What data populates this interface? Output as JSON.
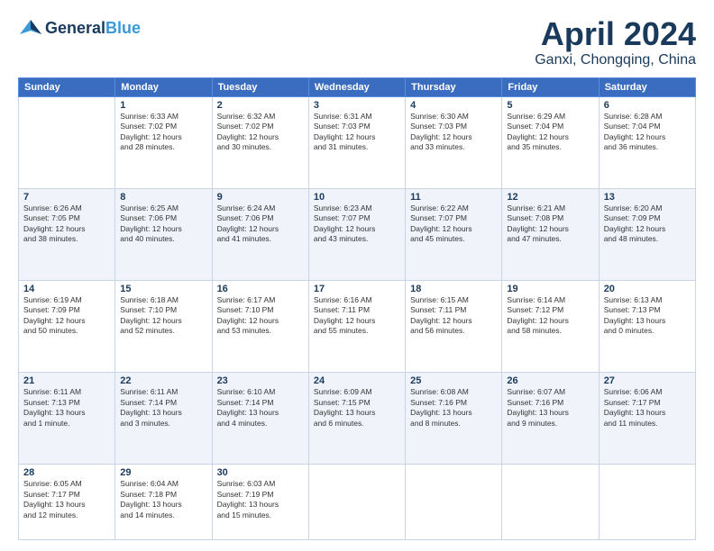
{
  "header": {
    "logo_line1": "General",
    "logo_line2": "Blue",
    "title": "April 2024",
    "subtitle": "Ganxi, Chongqing, China"
  },
  "columns": [
    "Sunday",
    "Monday",
    "Tuesday",
    "Wednesday",
    "Thursday",
    "Friday",
    "Saturday"
  ],
  "weeks": [
    [
      {
        "num": "",
        "info": ""
      },
      {
        "num": "1",
        "info": "Sunrise: 6:33 AM\nSunset: 7:02 PM\nDaylight: 12 hours\nand 28 minutes."
      },
      {
        "num": "2",
        "info": "Sunrise: 6:32 AM\nSunset: 7:02 PM\nDaylight: 12 hours\nand 30 minutes."
      },
      {
        "num": "3",
        "info": "Sunrise: 6:31 AM\nSunset: 7:03 PM\nDaylight: 12 hours\nand 31 minutes."
      },
      {
        "num": "4",
        "info": "Sunrise: 6:30 AM\nSunset: 7:03 PM\nDaylight: 12 hours\nand 33 minutes."
      },
      {
        "num": "5",
        "info": "Sunrise: 6:29 AM\nSunset: 7:04 PM\nDaylight: 12 hours\nand 35 minutes."
      },
      {
        "num": "6",
        "info": "Sunrise: 6:28 AM\nSunset: 7:04 PM\nDaylight: 12 hours\nand 36 minutes."
      }
    ],
    [
      {
        "num": "7",
        "info": "Sunrise: 6:26 AM\nSunset: 7:05 PM\nDaylight: 12 hours\nand 38 minutes."
      },
      {
        "num": "8",
        "info": "Sunrise: 6:25 AM\nSunset: 7:06 PM\nDaylight: 12 hours\nand 40 minutes."
      },
      {
        "num": "9",
        "info": "Sunrise: 6:24 AM\nSunset: 7:06 PM\nDaylight: 12 hours\nand 41 minutes."
      },
      {
        "num": "10",
        "info": "Sunrise: 6:23 AM\nSunset: 7:07 PM\nDaylight: 12 hours\nand 43 minutes."
      },
      {
        "num": "11",
        "info": "Sunrise: 6:22 AM\nSunset: 7:07 PM\nDaylight: 12 hours\nand 45 minutes."
      },
      {
        "num": "12",
        "info": "Sunrise: 6:21 AM\nSunset: 7:08 PM\nDaylight: 12 hours\nand 47 minutes."
      },
      {
        "num": "13",
        "info": "Sunrise: 6:20 AM\nSunset: 7:09 PM\nDaylight: 12 hours\nand 48 minutes."
      }
    ],
    [
      {
        "num": "14",
        "info": "Sunrise: 6:19 AM\nSunset: 7:09 PM\nDaylight: 12 hours\nand 50 minutes."
      },
      {
        "num": "15",
        "info": "Sunrise: 6:18 AM\nSunset: 7:10 PM\nDaylight: 12 hours\nand 52 minutes."
      },
      {
        "num": "16",
        "info": "Sunrise: 6:17 AM\nSunset: 7:10 PM\nDaylight: 12 hours\nand 53 minutes."
      },
      {
        "num": "17",
        "info": "Sunrise: 6:16 AM\nSunset: 7:11 PM\nDaylight: 12 hours\nand 55 minutes."
      },
      {
        "num": "18",
        "info": "Sunrise: 6:15 AM\nSunset: 7:11 PM\nDaylight: 12 hours\nand 56 minutes."
      },
      {
        "num": "19",
        "info": "Sunrise: 6:14 AM\nSunset: 7:12 PM\nDaylight: 12 hours\nand 58 minutes."
      },
      {
        "num": "20",
        "info": "Sunrise: 6:13 AM\nSunset: 7:13 PM\nDaylight: 13 hours\nand 0 minutes."
      }
    ],
    [
      {
        "num": "21",
        "info": "Sunrise: 6:11 AM\nSunset: 7:13 PM\nDaylight: 13 hours\nand 1 minute."
      },
      {
        "num": "22",
        "info": "Sunrise: 6:11 AM\nSunset: 7:14 PM\nDaylight: 13 hours\nand 3 minutes."
      },
      {
        "num": "23",
        "info": "Sunrise: 6:10 AM\nSunset: 7:14 PM\nDaylight: 13 hours\nand 4 minutes."
      },
      {
        "num": "24",
        "info": "Sunrise: 6:09 AM\nSunset: 7:15 PM\nDaylight: 13 hours\nand 6 minutes."
      },
      {
        "num": "25",
        "info": "Sunrise: 6:08 AM\nSunset: 7:16 PM\nDaylight: 13 hours\nand 8 minutes."
      },
      {
        "num": "26",
        "info": "Sunrise: 6:07 AM\nSunset: 7:16 PM\nDaylight: 13 hours\nand 9 minutes."
      },
      {
        "num": "27",
        "info": "Sunrise: 6:06 AM\nSunset: 7:17 PM\nDaylight: 13 hours\nand 11 minutes."
      }
    ],
    [
      {
        "num": "28",
        "info": "Sunrise: 6:05 AM\nSunset: 7:17 PM\nDaylight: 13 hours\nand 12 minutes."
      },
      {
        "num": "29",
        "info": "Sunrise: 6:04 AM\nSunset: 7:18 PM\nDaylight: 13 hours\nand 14 minutes."
      },
      {
        "num": "30",
        "info": "Sunrise: 6:03 AM\nSunset: 7:19 PM\nDaylight: 13 hours\nand 15 minutes."
      },
      {
        "num": "",
        "info": ""
      },
      {
        "num": "",
        "info": ""
      },
      {
        "num": "",
        "info": ""
      },
      {
        "num": "",
        "info": ""
      }
    ]
  ]
}
